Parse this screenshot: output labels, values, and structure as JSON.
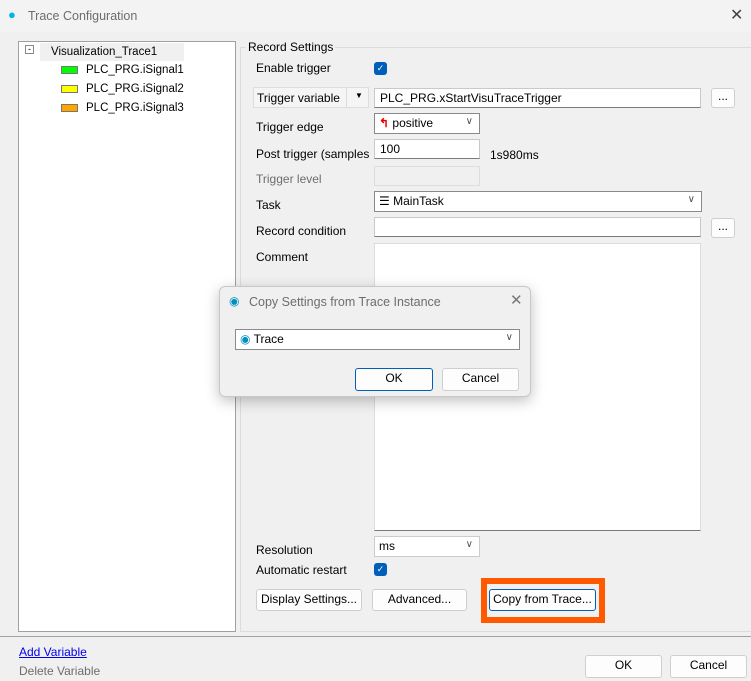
{
  "window": {
    "title": "Trace Configuration"
  },
  "tree": {
    "root": "Visualization_Trace1",
    "items": [
      {
        "label": "PLC_PRG.iSignal1",
        "color": "#00ff00"
      },
      {
        "label": "PLC_PRG.iSignal2",
        "color": "#ffff00"
      },
      {
        "label": "PLC_PRG.iSignal3",
        "color": "#ffa500"
      }
    ]
  },
  "record": {
    "group_label": "Record Settings",
    "enable_trigger": "Enable trigger",
    "trigger_variable": "Trigger variable",
    "trigger_variable_value": "PLC_PRG.xStartVisuTraceTrigger",
    "browse": "...",
    "trigger_edge": "Trigger edge",
    "trigger_edge_value": "positive",
    "post_trigger": "Post trigger (samples",
    "post_trigger_value": "100",
    "post_trigger_time": "1s980ms",
    "trigger_level": "Trigger  level",
    "task": "Task",
    "task_value": "MainTask",
    "record_condition": "Record condition",
    "comment": "Comment",
    "resolution": "Resolution",
    "resolution_value": "ms",
    "automatic_restart": "Automatic restart",
    "display_settings": "Display Settings...",
    "advanced": "Advanced...",
    "copy_from_trace": "Copy from Trace...",
    "highlight_color": "#ff5a00"
  },
  "footer": {
    "add_variable": "Add Variable",
    "delete_variable": "Delete Variable",
    "ok": "OK",
    "cancel": "Cancel"
  },
  "modal": {
    "title": "Copy Settings from Trace Instance",
    "selected": "Trace",
    "ok": "OK",
    "cancel": "Cancel"
  }
}
